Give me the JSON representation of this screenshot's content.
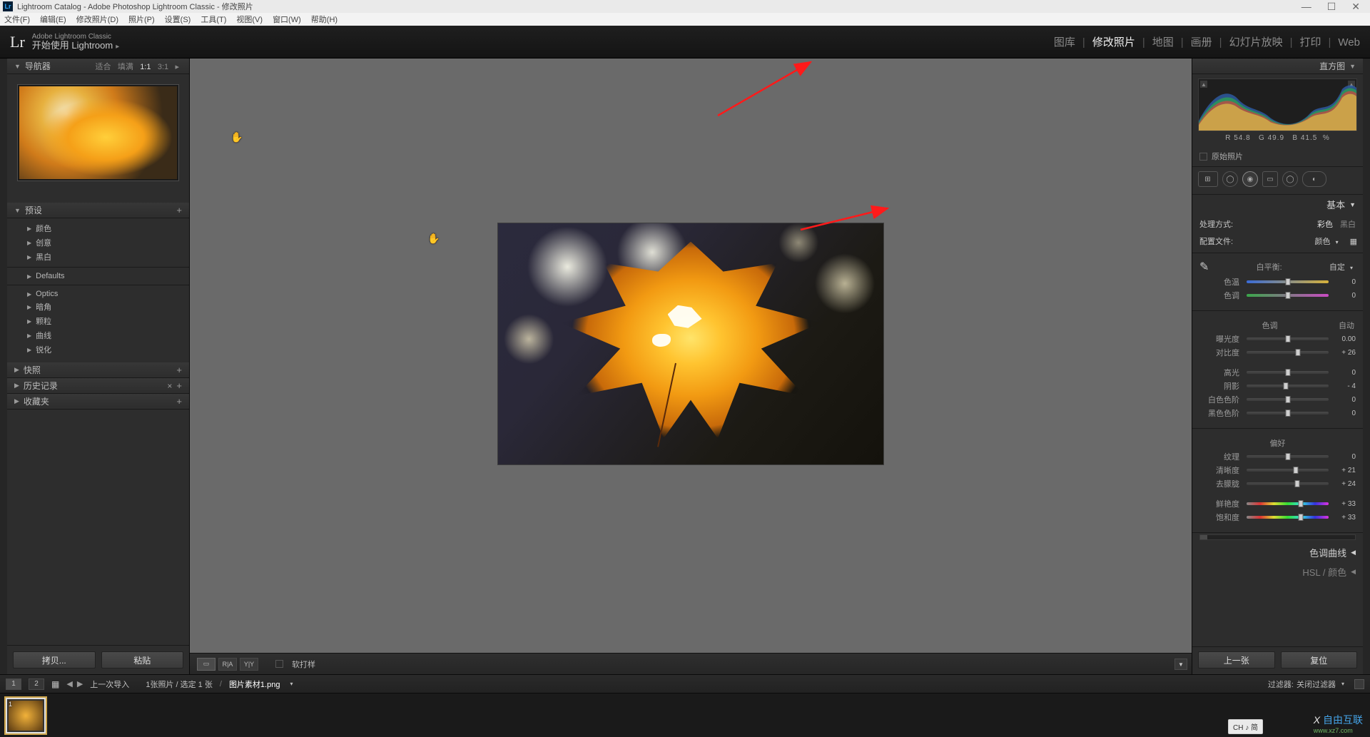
{
  "window": {
    "title": "Lightroom Catalog - Adobe Photoshop Lightroom Classic - 修改照片"
  },
  "menu": [
    "文件(F)",
    "编辑(E)",
    "修改照片(D)",
    "照片(P)",
    "设置(S)",
    "工具(T)",
    "视图(V)",
    "窗口(W)",
    "帮助(H)"
  ],
  "brand": {
    "logo": "Lr",
    "line1": "Adobe Lightroom Classic",
    "line2": "开始使用 Lightroom"
  },
  "modules": {
    "items": [
      "图库",
      "修改照片",
      "地图",
      "画册",
      "幻灯片放映",
      "打印",
      "Web"
    ],
    "active_index": 1
  },
  "left": {
    "navigator": {
      "title": "导航器",
      "zoom_opts": [
        "适合",
        "填满",
        "1:1",
        "3:1"
      ],
      "zoom_tri": "▸"
    },
    "presets": {
      "title": "预设",
      "items": [
        "颜色",
        "创意",
        "黑白"
      ],
      "defaults_label": "Defaults",
      "extra": [
        "Optics",
        "暗角",
        "颗粒",
        "曲线",
        "锐化"
      ]
    },
    "snapshots": {
      "title": "快照"
    },
    "history": {
      "title": "历史记录"
    },
    "collections": {
      "title": "收藏夹"
    },
    "buttons": {
      "copy": "拷贝...",
      "paste": "粘贴"
    }
  },
  "toolbar": {
    "view_single_icon": "▭",
    "view_compare_icon": "R|A",
    "view_ref_icon": "Y|Y",
    "softproof_label": "软打样"
  },
  "right": {
    "histogram": {
      "title": "直方图",
      "readout": {
        "r_label": "R",
        "r": "54.8",
        "g_label": "G",
        "g": "49.9",
        "b_label": "B",
        "b": "41.5",
        "pct": "%"
      },
      "original_label": "原始照片"
    },
    "basic": {
      "title": "基本",
      "treatment_label": "处理方式:",
      "treat_color": "彩色",
      "treat_bw": "黑白",
      "profile_label": "配置文件:",
      "profile_value": "颜色",
      "wb": {
        "label": "白平衡:",
        "mode": "自定"
      },
      "temp": {
        "label": "色温",
        "value": "0",
        "pos": 50
      },
      "tint": {
        "label": "色调",
        "value": "0",
        "pos": 50
      },
      "tone_title": "色调",
      "auto_label": "自动",
      "exposure": {
        "label": "曝光度",
        "value": "0.00",
        "pos": 50
      },
      "contrast": {
        "label": "对比度",
        "value": "+ 26",
        "pos": 63
      },
      "highlights": {
        "label": "高光",
        "value": "0",
        "pos": 50
      },
      "shadows": {
        "label": "阴影",
        "value": "- 4",
        "pos": 48
      },
      "whites": {
        "label": "白色色阶",
        "value": "0",
        "pos": 50
      },
      "blacks": {
        "label": "黑色色阶",
        "value": "0",
        "pos": 50
      },
      "presence_title": "偏好",
      "texture": {
        "label": "纹理",
        "value": "0",
        "pos": 50
      },
      "clarity": {
        "label": "清晰度",
        "value": "+ 21",
        "pos": 60
      },
      "dehaze": {
        "label": "去朦胧",
        "value": "+ 24",
        "pos": 62
      },
      "vibrance": {
        "label": "鲜艳度",
        "value": "+ 33",
        "pos": 66
      },
      "saturation": {
        "label": "饱和度",
        "value": "+ 33",
        "pos": 66
      }
    },
    "tone_curve_title": "色调曲线",
    "hsl_title": "HSL / 颜色",
    "prev_button": "上一张",
    "reset_button": "复位"
  },
  "bottom": {
    "pages": [
      "1",
      "2"
    ],
    "last_import": "上一次导入",
    "count_text": "1张照片 / 选定 1 张",
    "filename": "图片素材1.png",
    "filter_label": "过滤器:",
    "filter_value": "关闭过滤器"
  },
  "filmstrip": {
    "thumb_index": "1"
  },
  "ime": "CH ♪ 简",
  "watermark": {
    "line1": "自由互联",
    "line2": "www.xz7.com"
  }
}
